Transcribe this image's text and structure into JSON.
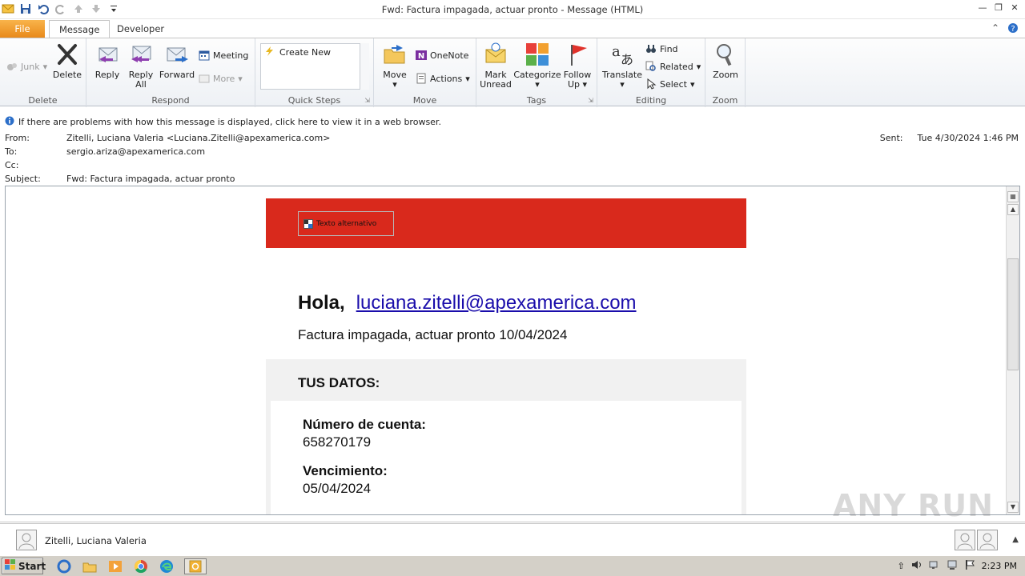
{
  "window": {
    "title": "Fwd: Factura impagada, actuar pronto  -  Message (HTML)"
  },
  "tabs": {
    "file": "File",
    "message": "Message",
    "developer": "Developer"
  },
  "ribbon": {
    "delete_group": {
      "junk": "Junk",
      "delete": "Delete",
      "label": "Delete"
    },
    "respond_group": {
      "reply": "Reply",
      "reply_all_1": "Reply",
      "reply_all_2": "All",
      "forward": "Forward",
      "meeting": "Meeting",
      "more": "More",
      "label": "Respond"
    },
    "quicksteps_group": {
      "create_new": "Create New",
      "label": "Quick Steps"
    },
    "move_group": {
      "move": "Move",
      "onenote": "OneNote",
      "actions": "Actions",
      "label": "Move"
    },
    "tags_group": {
      "mark_1": "Mark",
      "mark_2": "Unread",
      "categorize": "Categorize",
      "follow_1": "Follow",
      "follow_2": "Up",
      "label": "Tags"
    },
    "editing_group": {
      "translate": "Translate",
      "find": "Find",
      "related": "Related",
      "select": "Select",
      "label": "Editing"
    },
    "zoom_group": {
      "zoom": "Zoom",
      "label": "Zoom"
    }
  },
  "infobar": {
    "text": "If there are problems with how this message is displayed, click here to view it in a web browser."
  },
  "header": {
    "from_label": "From:",
    "from_value": "Zitelli, Luciana Valeria <Luciana.Zitelli@apexamerica.com>",
    "to_label": "To:",
    "to_value": "sergio.ariza@apexamerica.com",
    "cc_label": "Cc:",
    "subject_label": "Subject:",
    "subject_value": "Fwd: Factura impagada, actuar pronto",
    "sent_label": "Sent:",
    "sent_value": "Tue 4/30/2024 1:46 PM"
  },
  "email": {
    "alt_text": "Texto alternativo",
    "greeting": "Hola,",
    "email_link": "luciana.zitelli@apexamerica.com",
    "subject_line": "Factura impagada, actuar pronto 10/04/2024",
    "section_title": "TUS DATOS:",
    "account_label": "Número de cuenta:",
    "account_value": "658270179",
    "due_label": "Vencimiento:",
    "due_value": "05/04/2024"
  },
  "people_pane": {
    "name": "Zitelli, Luciana Valeria"
  },
  "watermark": "ANY RUN",
  "taskbar": {
    "start": "Start",
    "clock": "2:23 PM"
  },
  "colors": {
    "banner_red": "#d9291c",
    "file_tab_orange": "#e8891a",
    "link_blue": "#1a0dab"
  }
}
